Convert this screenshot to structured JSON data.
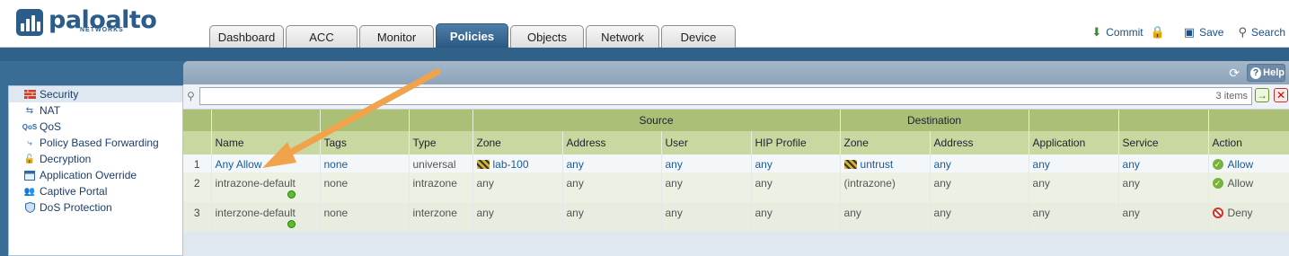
{
  "brand": {
    "name": "paloalto",
    "sub": "NETWORKS"
  },
  "tabs": [
    "Dashboard",
    "ACC",
    "Monitor",
    "Policies",
    "Objects",
    "Network",
    "Device"
  ],
  "active_tab": "Policies",
  "toolbar": {
    "commit": "Commit",
    "save": "Save",
    "search": "Search"
  },
  "panel": {
    "help": "Help",
    "items_count": "3 items"
  },
  "sidebar": {
    "items": [
      {
        "label": "Security",
        "icon": "firewall-icon"
      },
      {
        "label": "NAT",
        "icon": "nat-icon"
      },
      {
        "label": "QoS",
        "icon": "qos-icon"
      },
      {
        "label": "Policy Based Forwarding",
        "icon": "forwarding-icon"
      },
      {
        "label": "Decryption",
        "icon": "lock-icon"
      },
      {
        "label": "Application Override",
        "icon": "app-override-icon"
      },
      {
        "label": "Captive Portal",
        "icon": "users-icon"
      },
      {
        "label": "DoS Protection",
        "icon": "shield-icon"
      }
    ]
  },
  "table": {
    "group_headers": {
      "source": "Source",
      "destination": "Destination"
    },
    "columns": [
      "Name",
      "Tags",
      "Type",
      "Zone",
      "Address",
      "User",
      "HIP Profile",
      "Zone",
      "Address",
      "Application",
      "Service",
      "Action"
    ],
    "rows": [
      {
        "num": "1",
        "name": "Any Allow",
        "tags": "none",
        "type": "universal",
        "src_zone": "lab-100",
        "src_address": "any",
        "user": "any",
        "hip": "any",
        "dst_zone": "untrust",
        "dst_address": "any",
        "application": "any",
        "service": "any",
        "action": "Allow"
      },
      {
        "num": "2",
        "name": "intrazone-default",
        "tags": "none",
        "type": "intrazone",
        "src_zone": "any",
        "src_address": "any",
        "user": "any",
        "hip": "any",
        "dst_zone": "(intrazone)",
        "dst_address": "any",
        "application": "any",
        "service": "any",
        "action": "Allow"
      },
      {
        "num": "3",
        "name": "interzone-default",
        "tags": "none",
        "type": "interzone",
        "src_zone": "any",
        "src_address": "any",
        "user": "any",
        "hip": "any",
        "dst_zone": "any",
        "dst_address": "any",
        "application": "any",
        "service": "any",
        "action": "Deny"
      }
    ]
  },
  "colors": {
    "brand": "#2b5c8a",
    "active_tab": "#2a5a84",
    "header_green": "#b7c889",
    "annotation_arrow": "#f0a34a"
  }
}
